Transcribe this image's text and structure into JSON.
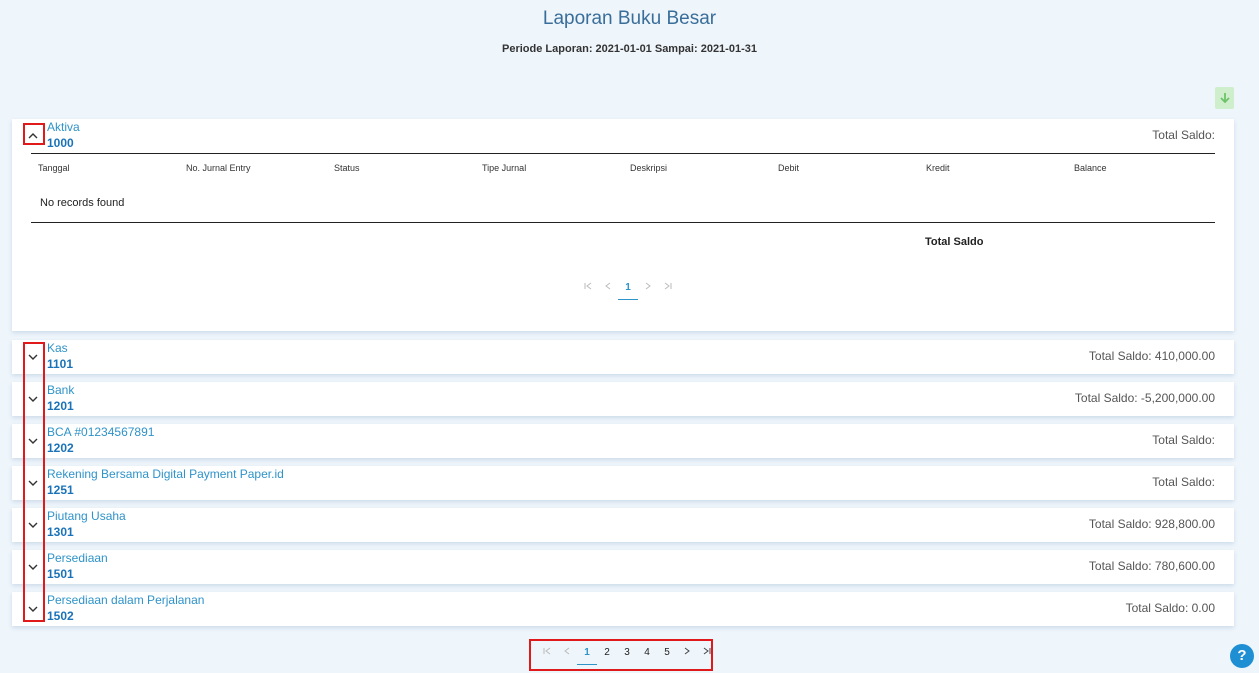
{
  "report": {
    "title": "Laporan Buku Besar",
    "period": "Periode Laporan: 2021-01-01 Sampai: 2021-01-31"
  },
  "expanded": {
    "name": "Aktiva",
    "code": "1000",
    "total": "Total Saldo:",
    "columns": [
      "Tanggal",
      "No. Jurnal Entry",
      "Status",
      "Tipe Jurnal",
      "Deskripsi",
      "Debit",
      "Kredit",
      "Balance"
    ],
    "empty_message": "No records found",
    "footer_total_label": "Total Saldo",
    "pager": {
      "current": "1"
    }
  },
  "accounts": [
    {
      "name": "Kas",
      "code": "1101",
      "total": "Total Saldo: 410,000.00"
    },
    {
      "name": "Bank",
      "code": "1201",
      "total": "Total Saldo: -5,200,000.00"
    },
    {
      "name": "BCA #01234567891",
      "code": "1202",
      "total": "Total Saldo:"
    },
    {
      "name": "Rekening Bersama Digital Payment Paper.id",
      "code": "1251",
      "total": "Total Saldo:"
    },
    {
      "name": "Piutang Usaha",
      "code": "1301",
      "total": "Total Saldo: 928,800.00"
    },
    {
      "name": "Persediaan",
      "code": "1501",
      "total": "Total Saldo: 780,600.00"
    },
    {
      "name": "Persediaan dalam Perjalanan",
      "code": "1502",
      "total": "Total Saldo: 0.00"
    }
  ],
  "pagination": {
    "pages": [
      "1",
      "2",
      "3",
      "4",
      "5"
    ],
    "current": "1"
  },
  "help": {
    "label": "?"
  },
  "colors": {
    "accent": "#2e93c9",
    "code": "#1a73b8",
    "highlight": "#e01a1a",
    "download": "#cfeecb",
    "background": "#eef5fb"
  },
  "icons": {
    "download": "download-arrow-icon",
    "expand": "chevron-down-icon",
    "collapse": "chevron-up-icon",
    "first": "first-page-icon",
    "prev": "chevron-left-icon",
    "next": "chevron-right-icon",
    "last": "last-page-icon",
    "help": "help-icon"
  }
}
